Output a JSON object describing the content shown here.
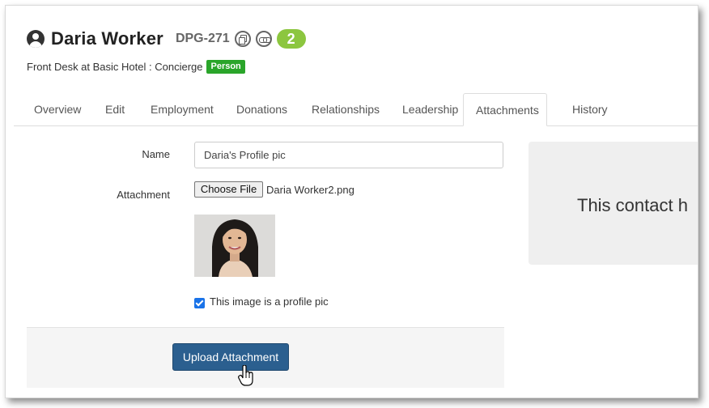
{
  "contact": {
    "name": "Daria Worker",
    "code": "DPG-271",
    "count": "2",
    "subtitle": "Front Desk at Basic Hotel : Concierge",
    "type_badge": "Person"
  },
  "tabs": [
    {
      "label": "Overview",
      "active": false
    },
    {
      "label": "Edit",
      "active": false
    },
    {
      "label": "Employment",
      "active": false
    },
    {
      "label": "Donations",
      "active": false
    },
    {
      "label": "Relationships",
      "active": false
    },
    {
      "label": "Leadership",
      "active": false
    },
    {
      "label": "Attachments",
      "active": true
    },
    {
      "label": "History",
      "active": false
    }
  ],
  "form": {
    "name_label": "Name",
    "name_value": "Daria's Profile pic",
    "attachment_label": "Attachment",
    "choose_file_label": "Choose File",
    "file_name": "Daria Worker2.png",
    "profile_pic_checkbox_label": "This image is a profile pic",
    "profile_pic_checked": true,
    "upload_button_label": "Upload Attachment"
  },
  "side_panel": {
    "message": "This contact h"
  },
  "colors": {
    "count_badge": "#8cc63f",
    "person_badge": "#2aa52a",
    "upload_button": "#2b5f8f",
    "checkbox": "#1a73e8"
  }
}
